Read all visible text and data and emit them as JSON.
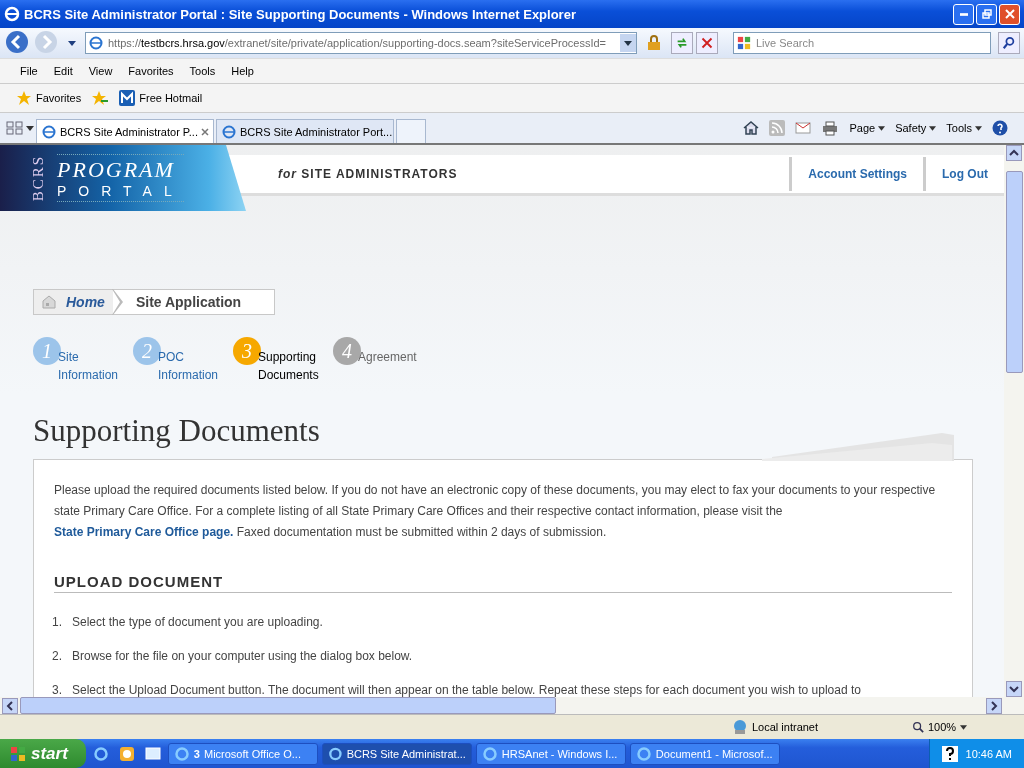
{
  "window": {
    "title": "BCRS Site Administrator Portal : Site Supporting Documents - Windows Internet Explorer"
  },
  "address_bar": {
    "url_scheme": "https://",
    "url_host": "testbcrs.hrsa.gov",
    "url_path": "/extranet/site/private/application/supporting-docs.seam?siteServiceProcessId=",
    "search_placeholder": "Live Search"
  },
  "menu_bar": [
    "File",
    "Edit",
    "View",
    "Favorites",
    "Tools",
    "Help"
  ],
  "favorites_bar": {
    "favorites": "Favorites",
    "links": [
      "Free Hotmail"
    ]
  },
  "tabs": [
    {
      "label": "BCRS Site Administrator P...",
      "selected": true
    },
    {
      "label": "BCRS Site Administrator Port...",
      "selected": false
    }
  ],
  "command_bar": [
    "Page",
    "Safety",
    "Tools"
  ],
  "page": {
    "logo": {
      "side": "BCRS",
      "top": "PROGRAM",
      "bottom": "PORTAL"
    },
    "tagline": "*for* SITE ADMINISTRATORS",
    "header_links": [
      "Account Settings",
      "Log Out"
    ],
    "breadcrumb": [
      {
        "label": "Home",
        "kind": "home"
      },
      {
        "label": "Site Application",
        "kind": "current"
      }
    ],
    "steps": [
      {
        "number": "1",
        "lines": [
          "Site",
          "Information"
        ],
        "selected": false,
        "disabled": false
      },
      {
        "number": "2",
        "lines": [
          "POC",
          "Information"
        ],
        "selected": false,
        "disabled": false
      },
      {
        "number": "3",
        "lines": [
          "Supporting",
          "Documents"
        ],
        "selected": true,
        "disabled": false
      },
      {
        "number": "4",
        "lines": [
          "Agreement"
        ],
        "selected": false,
        "disabled": true
      }
    ],
    "heading": "Supporting Documents",
    "intro": {
      "before": "Please upload the required documents listed below. If you do not have an electronic copy of these documents, you may elect to fax your documents to your respective state Primary Care Office. For a complete listing of all State Primary Care Offices and their respective contact information, please visit the ",
      "link": "State Primary Care Office page.",
      "after": " Faxed documentation must be submitted within 2 days of submission."
    },
    "section_heading": "UPLOAD DOCUMENT",
    "instructions": [
      {
        "number": "1.",
        "text": "Select the type of document you are uploading."
      },
      {
        "number": "2.",
        "text": "Browse for the file on your computer using the dialog box below."
      },
      {
        "number": "3.",
        "text": "Select the Upload Document button. The document will then appear on the table below. Repeat these steps for each document you wish to upload to"
      }
    ]
  },
  "status_bar": {
    "zone": "Local intranet",
    "zoom": "100%"
  },
  "taskbar": {
    "start": "start",
    "items": [
      {
        "label": "Microsoft Office O...",
        "count": "3",
        "selected": false
      },
      {
        "label": "BCRS Site Administrat...",
        "selected": true
      },
      {
        "label": "HRSAnet - Windows I...",
        "selected": false
      },
      {
        "label": "Document1 - Microsof...",
        "selected": false
      }
    ],
    "clock": "10:46 AM"
  }
}
